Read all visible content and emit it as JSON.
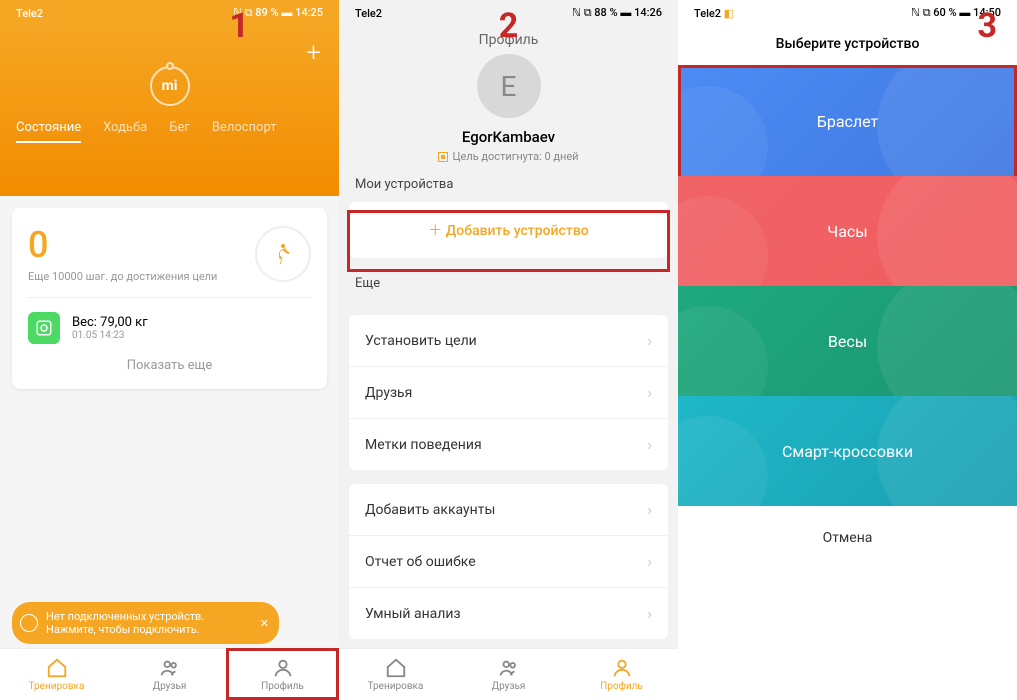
{
  "steps": {
    "s1": "1",
    "s2": "2",
    "s3": "3"
  },
  "status": {
    "carrier": "Tele2",
    "signal_icons": "📶 📡",
    "p1_right": "ℕ ⧉ 89 % ▬ 14:25",
    "p2_right": "ℕ ⧉ 88 % ▬ 14:26",
    "p3_right": "ℕ ⧉ 60 % ▬ 14:50",
    "p3_extra_icon": "◧"
  },
  "phone1": {
    "tabs": {
      "status": "Состояние",
      "walk": "Ходьба",
      "run": "Бег",
      "bike": "Велоспорт"
    },
    "steps_value": "0",
    "steps_goal": "Еще 10000 шаг. до достижения цели",
    "weight_label": "Вес: 79,00  кг",
    "weight_date": "01.05 14:23",
    "show_more": "Показать еще",
    "toast": "Нет подключенных устройств. Нажмите, чтобы подключить."
  },
  "nav": {
    "train": "Тренировка",
    "friends": "Друзья",
    "profile": "Профиль"
  },
  "phone2": {
    "header": "Профиль",
    "avatar_letter": "E",
    "username": "EgorKambaev",
    "goal": "Цель достигнута: 0 дней",
    "section_devices": "Мои устройства",
    "add_device": "Добавить устройство",
    "section_more": "Еще",
    "list1": {
      "goals": "Установить цели",
      "friends": "Друзья",
      "behavior": "Метки поведения"
    },
    "list2": {
      "accounts": "Добавить аккаунты",
      "bug": "Отчет об ошибке",
      "smart": "Умный анализ"
    }
  },
  "phone3": {
    "title": "Выберите устройство",
    "bracelet": "Браслет",
    "watch": "Часы",
    "scale": "Весы",
    "shoes": "Смарт-кроссовки",
    "cancel": "Отмена"
  }
}
